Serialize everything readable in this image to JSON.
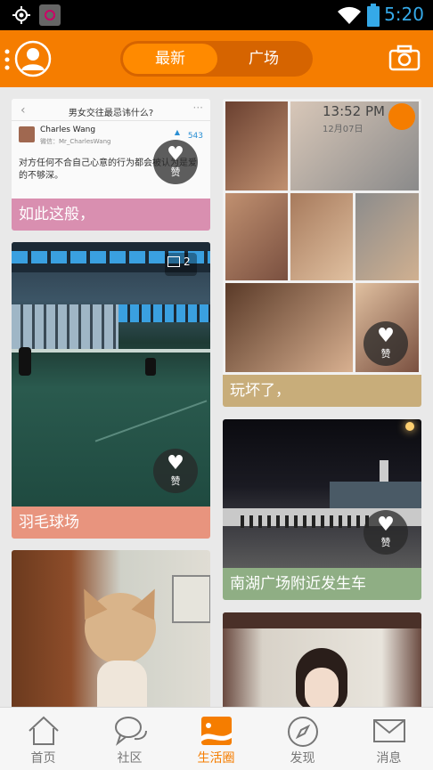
{
  "status": {
    "time": "5:20"
  },
  "header": {
    "tabs": [
      {
        "label": "最新",
        "active": true
      },
      {
        "label": "广场",
        "active": false
      }
    ]
  },
  "feed": {
    "left": [
      {
        "caption": "如此这般，",
        "caption_color": "#d98fb0",
        "post": {
          "title": "男女交往最忌讳什么?",
          "author": "Charles Wang",
          "wechat": "微信：Mr_CharlesWang",
          "votes": "543",
          "body": "对方任何不合自己心意的行为都会被认为是爱的不够深。"
        },
        "like_label": "赞"
      },
      {
        "caption": "羽毛球场",
        "caption_color": "#e8947e",
        "photo_count": "2",
        "like_label": "赞"
      },
      {
        "caption": "",
        "caption_color": "#e8947e"
      }
    ],
    "right": [
      {
        "caption": "玩坏了，",
        "caption_color": "#c8ad7a",
        "photo_time": "13:52 PM",
        "photo_date": "12月07日",
        "like_label": "赞"
      },
      {
        "caption": "南湖广场附近发生车",
        "caption_color": "#8fae84",
        "like_label": "赞"
      },
      {
        "caption": "",
        "caption_color": "#8fae84"
      }
    ]
  },
  "bottom_nav": [
    {
      "label": "首页",
      "icon": "home-icon",
      "active": false
    },
    {
      "label": "社区",
      "icon": "chat-bubbles-icon",
      "active": false
    },
    {
      "label": "生活圈",
      "icon": "image-card-icon",
      "active": true
    },
    {
      "label": "发现",
      "icon": "compass-icon",
      "active": false
    },
    {
      "label": "消息",
      "icon": "mail-icon",
      "active": false
    }
  ],
  "colors": {
    "brand": "#f57d00",
    "status_time": "#35a9e8"
  }
}
